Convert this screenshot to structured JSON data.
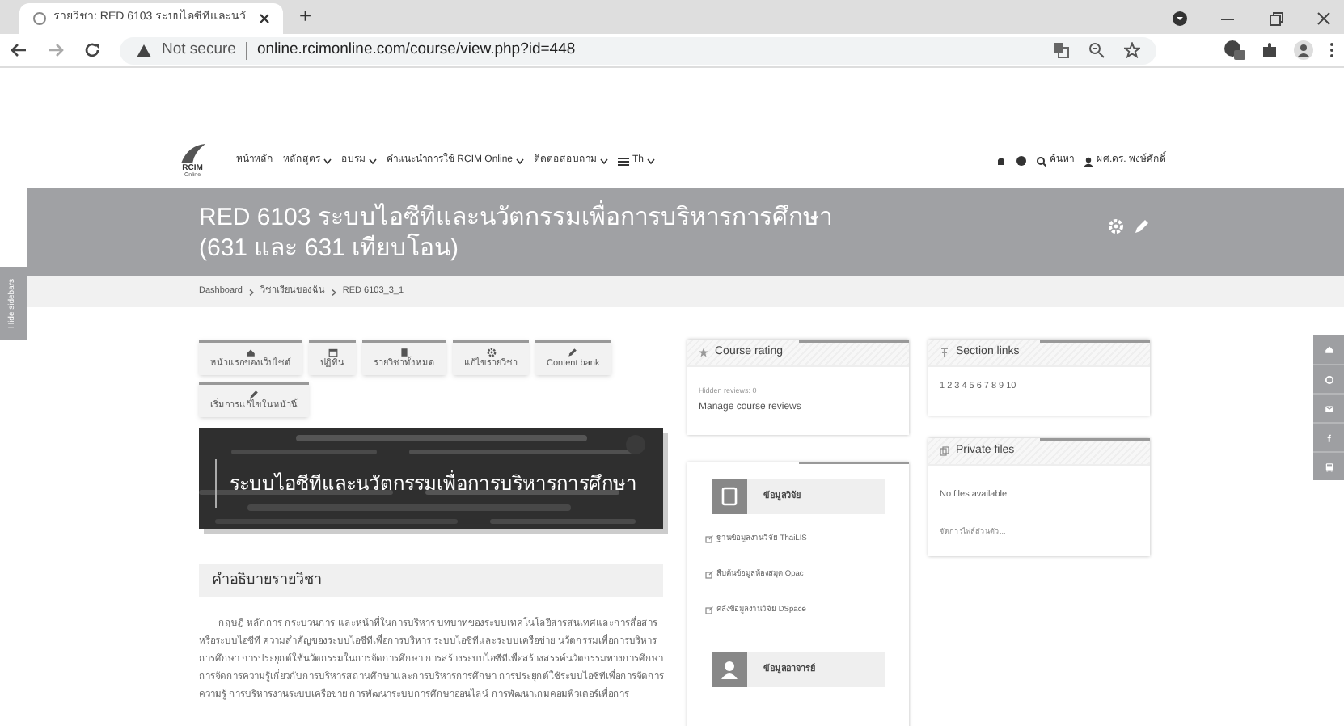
{
  "browser": {
    "tab_title": "รายวิชา: RED 6103 ระบบไอซีทีและนวั",
    "new_tab": "+",
    "security": "Not secure",
    "url": "online.rcimonline.com/course/view.php?id=448"
  },
  "navbar": {
    "logo": "RCIM",
    "logo_sub": "Online",
    "menu": [
      {
        "label": "หน้าหลัก",
        "dropdown": false
      },
      {
        "label": "หลักสูตร",
        "dropdown": true
      },
      {
        "label": "อบรม",
        "dropdown": true
      },
      {
        "label": "คำแนะนำการใช้ RCIM Online",
        "dropdown": true
      },
      {
        "label": "ติดต่อสอบถาม",
        "dropdown": true
      },
      {
        "label": "Th",
        "dropdown": true
      }
    ],
    "search": "ค้นหา",
    "user": "ผศ.ดร. พงษ์ศักดิ์"
  },
  "header": {
    "title": "RED 6103 ระบบไอซีทีและนวัตกรรมเพื่อการบริหารการศึกษา (631 และ 631 เทียบโอน)",
    "breadcrumb": [
      "Dashboard",
      "วิชาเรียนของฉัน",
      "RED 6103_3_1"
    ],
    "sidebar_toggle": "Hide sidebars"
  },
  "actions": [
    {
      "label": "หน้าแรกของเว็บไซต์",
      "kind": "home"
    },
    {
      "label": "ปฏิทิน",
      "kind": "calendar"
    },
    {
      "label": "รายวิชาทั้งหมด",
      "kind": "books"
    },
    {
      "label": "แก้ไขรายวิชา",
      "kind": "gear"
    },
    {
      "label": "Content bank",
      "kind": "pencil"
    },
    {
      "label": "เริ่มการแก้ไขในหน้านี้",
      "kind": "pencil"
    }
  ],
  "banner": {
    "kind": "picture",
    "title": "ระบบไอซีทีและนวัตกรรมเพื่อการบริหารการศึกษา"
  },
  "description": {
    "heading": "คำอธิบายรายวิชา",
    "text": "กฤษฎี หลักการ กระบวนการ และหน้าที่ในการบริหาร บทบาทของระบบเทคโนโลยีสารสนเทศและการสื่อสารหรือระบบไอซีที ความสำคัญของระบบไอซีทีเพื่อการบริหาร ระบบไอซีทีและระบบเครือข่าย นวัตกรรมเพื่อการบริหารการศึกษา การประยุกต์ใช้นวัตกรรมในการจัดการศึกษา การสร้างระบบไอซีทีเพื่อสร้างสรรค์นวัตกรรมทางการศึกษา การจัดการความรู้เกี่ยวกับการบริหารสถานศึกษาและการบริหารการศึกษา การประยุกต์ใช้ระบบไอซีทีเพื่อการจัดการความรู้ การบริหารงานระบบเครือข่าย การพัฒนาระบบการศึกษาออนไลน์ การพัฒนาเกมคอมพิวเตอร์เพื่อการ"
  },
  "course_rating": {
    "title": "Course rating",
    "hidden": "Hidden reviews: 0",
    "manage": "Manage course reviews"
  },
  "research": {
    "title": "ข้อมูลวิจัย",
    "links": [
      "ฐานข้อมูลงานวิจัย ThaiLIS",
      "สืบค้นข้อมูลห้องสมุด Opac",
      "คลังข้อมูลงานวิจัย DSpace"
    ],
    "teacher": "ข้อมูลอาจารย์"
  },
  "section_links": {
    "title": "Section links",
    "links": [
      "1",
      "2",
      "3",
      "4",
      "5",
      "6",
      "7",
      "8",
      "9",
      "10"
    ]
  },
  "private_files": {
    "title": "Private files",
    "empty": "No files available",
    "manage": "จัดการไฟล์ส่วนตัว..."
  },
  "float_icons": [
    {
      "kind": "home"
    },
    {
      "kind": "circle"
    },
    {
      "kind": "mail"
    },
    {
      "kind": "facebook"
    },
    {
      "kind": "bus"
    }
  ]
}
